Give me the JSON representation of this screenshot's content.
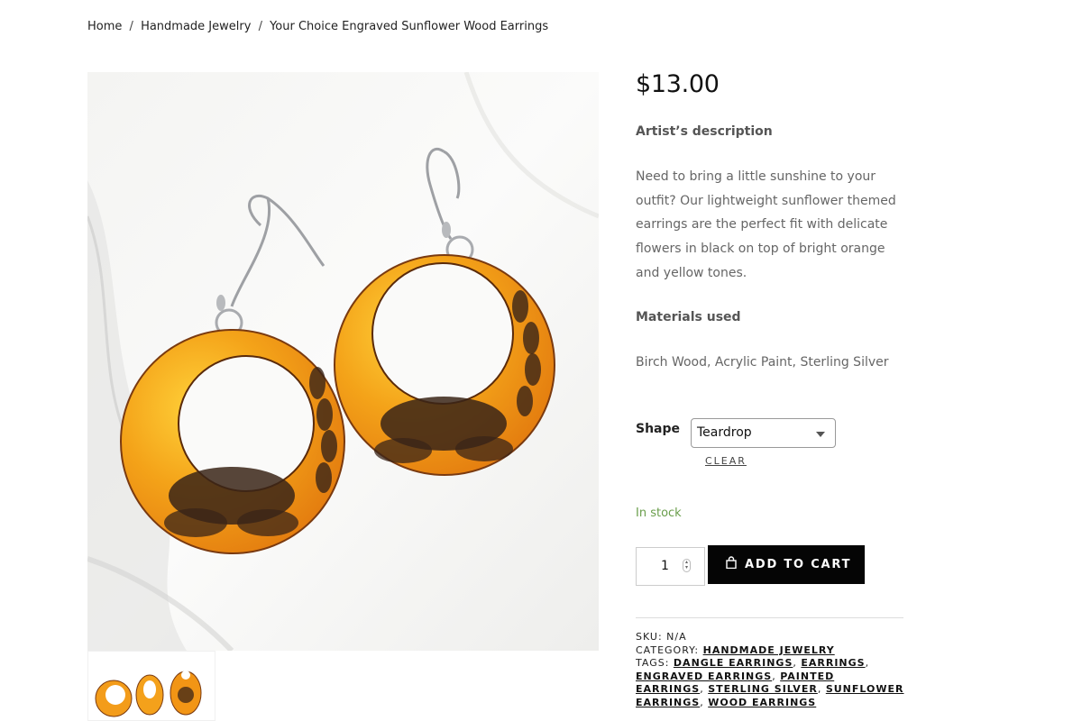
{
  "breadcrumb": {
    "home": "Home",
    "category": "Handmade Jewelry",
    "current": "Your Choice Engraved Sunflower Wood Earrings",
    "separator": "/"
  },
  "product": {
    "price": "$13.00",
    "artist_heading": "Artist’s description",
    "description": "Need to bring a little sunshine to your outfit? Our lightweight sunflower themed earrings are the perfect fit with delicate flowers in black on top of bright orange and yellow tones.",
    "materials_heading": "Materials used",
    "materials": "Birch Wood, Acrylic Paint, Sterling Silver"
  },
  "variation": {
    "label": "Shape",
    "selected": "Teardrop",
    "clear_label": "CLEAR"
  },
  "stock": {
    "text": "In stock",
    "color": "#6a9e4c"
  },
  "cart": {
    "quantity": "1",
    "button_label": "ADD TO CART",
    "button_color": "#050505",
    "icon": "shopping-bag-icon"
  },
  "meta": {
    "sku_label": "SKU:",
    "sku_value": "N/A",
    "category_label": "CATEGORY:",
    "category_value": "HANDMADE JEWELRY",
    "tags_label": "TAGS:",
    "tags": [
      "DANGLE EARRINGS",
      "EARRINGS",
      "ENGRAVED EARRINGS",
      "PAINTED EARRINGS",
      "STERLING SILVER",
      "SUNFLOWER EARRINGS",
      "WOOD EARRINGS"
    ]
  },
  "colors": {
    "accent_orange": "#f08a12",
    "text_muted": "#666666"
  }
}
